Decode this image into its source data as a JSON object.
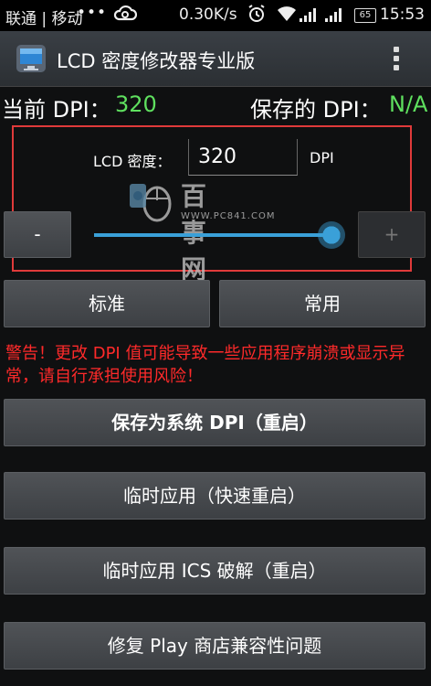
{
  "status_bar": {
    "carrier": "联通 | 移动",
    "dots": "•••",
    "speed": "0.30K/s",
    "battery": "65",
    "time": "15:53",
    "icons": [
      "cloud-icon",
      "alarm-icon",
      "wifi-icon",
      "signal-icon",
      "signal-icon",
      "battery-icon"
    ]
  },
  "app_bar": {
    "title": "LCD 密度修改器专业版",
    "icon": "monitor-icon",
    "menu_icon": "overflow-menu-icon"
  },
  "dpi_status": {
    "current_label": "当前 DPI：",
    "current_value": "320",
    "saved_label": "保存的 DPI：",
    "saved_value": "N/A"
  },
  "density": {
    "label": "LCD 密度：",
    "value": "320",
    "unit": "DPI",
    "decrement_label": "-",
    "increment_label": "+",
    "slider_fraction": 1.0
  },
  "watermark": {
    "title": "百事网",
    "url": "WWW.PC841.COM"
  },
  "presets": {
    "standard": "标准",
    "common": "常用"
  },
  "warning": "警告！更改 DPI 值可能导致一些应用程序崩溃或显示异常，请自行承担使用风险！",
  "actions": {
    "save_system": "保存为系统 DPI（重启）",
    "temp_apply": "临时应用（快速重启）",
    "temp_ics": "临时应用 ICS 破解（重启）",
    "fix_play": "修复 Play 商店兼容性问题"
  },
  "colors": {
    "accent": "#3aa0d8",
    "value_green": "#5fe05f",
    "warning_red": "#ff2a2a",
    "highlight_border": "#e03a3a"
  }
}
